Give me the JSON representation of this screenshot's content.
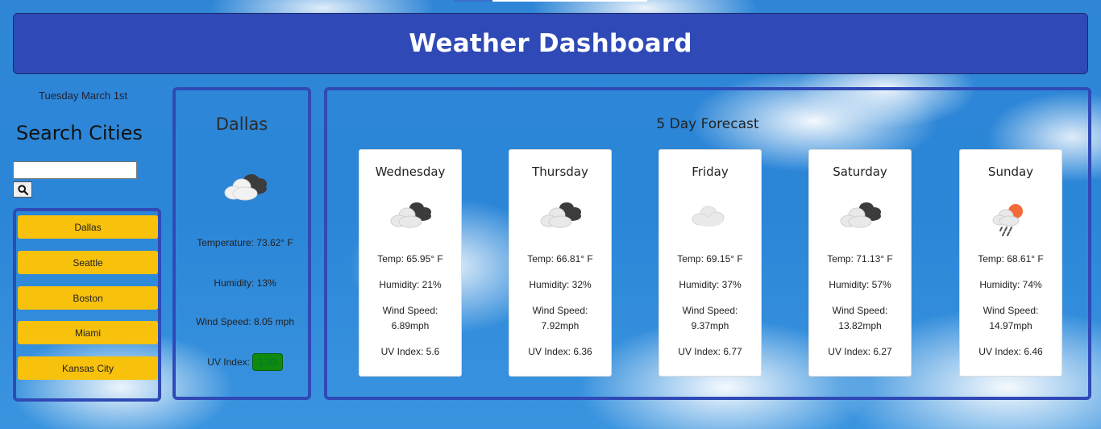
{
  "header": {
    "title": "Weather Dashboard"
  },
  "date": "Tuesday March 1st",
  "search": {
    "title": "Search Cities",
    "input_value": "",
    "button_icon": "search-icon"
  },
  "cities": [
    "Dallas",
    "Seattle",
    "Boston",
    "Miami",
    "Kansas City"
  ],
  "colors": {
    "header": "#2f4ab6",
    "city_button": "#f7c10c",
    "uv_good": "#0e8a0e"
  },
  "current": {
    "city": "Dallas",
    "icon": "partly-cloudy-dark-icon",
    "temperature": "Temperature: 73.62° F",
    "humidity": "Humidity: 13%",
    "wind": "Wind Speed: 8.05 mph",
    "uv_label": "UV Index:",
    "uv_value": "1.33"
  },
  "forecast": {
    "title": "5 Day Forecast",
    "days": [
      {
        "day": "Wednesday",
        "icon": "broken-clouds-icon",
        "temp": "Temp: 65.95° F",
        "humidity": "Humidity: 21%",
        "wind_label": "Wind Speed:",
        "wind_value": "6.89mph",
        "uv": "UV Index: 5.6"
      },
      {
        "day": "Thursday",
        "icon": "broken-clouds-icon",
        "temp": "Temp: 66.81° F",
        "humidity": "Humidity: 32%",
        "wind_label": "Wind Speed:",
        "wind_value": "7.92mph",
        "uv": "UV Index: 6.36"
      },
      {
        "day": "Friday",
        "icon": "cloud-icon",
        "temp": "Temp: 69.15° F",
        "humidity": "Humidity: 37%",
        "wind_label": "Wind Speed:",
        "wind_value": "9.37mph",
        "uv": "UV Index: 6.77"
      },
      {
        "day": "Saturday",
        "icon": "broken-clouds-icon",
        "temp": "Temp: 71.13° F",
        "humidity": "Humidity: 57%",
        "wind_label": "Wind Speed:",
        "wind_value": "13.82mph",
        "uv": "UV Index: 6.27"
      },
      {
        "day": "Sunday",
        "icon": "rain-sun-icon",
        "temp": "Temp: 68.61° F",
        "humidity": "Humidity: 74%",
        "wind_label": "Wind Speed:",
        "wind_value": "14.97mph",
        "uv": "UV Index: 6.46"
      }
    ]
  }
}
